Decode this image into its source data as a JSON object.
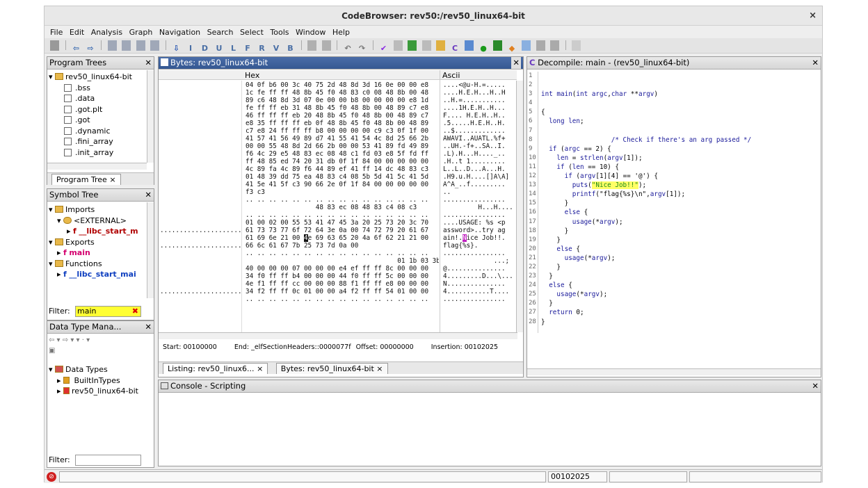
{
  "window": {
    "title": "CodeBrowser: rev50:/rev50_linux64-bit",
    "close": "×"
  },
  "menu": [
    "File",
    "Edit",
    "Analysis",
    "Graph",
    "Navigation",
    "Search",
    "Select",
    "Tools",
    "Window",
    "Help"
  ],
  "toolbar": [
    "⇦",
    "⇨",
    "I",
    "D",
    "U",
    "L",
    "F",
    "R",
    "V",
    "B"
  ],
  "program_trees": {
    "title": "Program Trees",
    "root": "rev50_linux64-bit",
    "items": [
      ".bss",
      ".data",
      ".got.plt",
      ".got",
      ".dynamic",
      ".fini_array",
      ".init_array"
    ],
    "tab": "Program Tree",
    "tab_close": "×"
  },
  "symbol_tree": {
    "title": "Symbol Tree",
    "imports": "Imports",
    "external": "<EXTERNAL>",
    "libc_import": "__libc_start_m",
    "exports": "Exports",
    "main": "main",
    "functions": "Functions",
    "libc_fn": "__libc_start_mai",
    "filter_label": "Filter:",
    "filter_value": "main"
  },
  "data_types": {
    "title": "Data Type Mana...",
    "root": "Data Types",
    "builtin": "BuiltInTypes",
    "program": "rev50_linux64-bit",
    "filter_label": "Filter:"
  },
  "bytes": {
    "title": "Bytes: rev50_linux64-bit",
    "hex_header": "Hex",
    "ascii_header": "Ascii",
    "addr_dots": [
      "",
      "",
      "",
      "",
      "",
      "",
      "",
      "",
      "",
      "",
      "",
      "",
      "",
      "",
      "",
      "",
      "",
      "",
      "",
      ".....................",
      "",
      ".....................",
      "",
      "",
      "",
      "",
      "",
      ".....................",
      "",
      "",
      "",
      "",
      "",
      "....................."
    ],
    "hex_rows": [
      "04 0f b6 00 3c 40 75 2d 48 8d 3d 16 0e 00 00 e8",
      "1c fe ff ff 48 8b 45 f0 48 83 c0 08 48 8b 00 48",
      "89 c6 48 8d 3d 07 0e 00 00 b8 00 00 00 00 e8 1d",
      "fe ff ff eb 31 48 8b 45 f0 48 8b 00 48 89 c7 e8",
      "46 ff ff ff eb 20 48 8b 45 f0 48 8b 00 48 89 c7",
      "e8 35 ff ff ff eb 0f 48 8b 45 f0 48 8b 00 48 89",
      "c7 e8 24 ff ff ff b8 00 00 00 00 c9 c3 0f 1f 00",
      "41 57 41 56 49 89 d7 41 55 41 54 4c 8d 25 66 2b",
      "00 00 55 48 8d 2d 66 2b 00 00 53 41 89 fd 49 89",
      "f6 4c 29 e5 48 83 ec 08 48 c1 fd 03 e8 5f fd ff",
      "ff 48 85 ed 74 20 31 db 0f 1f 84 00 00 00 00 00",
      "4c 89 fa 4c 89 f6 44 89 ef 41 ff 14 dc 48 83 c3",
      "01 48 39 dd 75 ea 48 83 c4 08 5b 5d 41 5c 41 5d",
      "41 5e 41 5f c3 90 66 2e 0f 1f 84 00 00 00 00 00",
      "f3 c3",
      ".. .. .. .. .. .. .. .. .. .. .. .. .. .. .. ..",
      "                  48 83 ec 08 48 83 c4 08 c3",
      ".. .. .. .. .. .. .. .. .. .. .. .. .. .. .. ..",
      "01 00 02 00 55 53 41 47 45 3a 20 25 73 20 3c 70",
      "61 73 73 77 6f 72 64 3e 0a 00 74 72 79 20 61 67",
      "61 69 6e 21 00 4e 69 63 65 20 4a 6f 62 21 21 00",
      "66 6c 61 67 7b 25 73 7d 0a 00",
      ".. .. .. .. .. .. .. .. .. .. .. .. .. .. .. ..",
      "                                       01 1b 03 3b",
      "40 00 00 00 07 00 00 00 e4 ef ff ff 8c 00 00 00",
      "34 f0 ff ff b4 00 00 00 44 f0 ff ff 5c 00 00 00",
      "4e f1 ff ff cc 00 00 00 88 f1 ff ff e8 00 00 00",
      "34 f2 ff ff 0c 01 00 00 a4 f2 ff ff 54 01 00 00",
      ".. .. .. .. .. .. .. .. .. .. .. .. .. .. .. .."
    ],
    "ascii_rows": [
      "....<@u-H.=.....",
      "....H.E.H...H..H",
      "..H.=...........",
      "....1H.E.H..H...",
      "F.... H.E.H..H..",
      ".5.....H.E.H..H.",
      "..$.............",
      "AWAVI..AUATL.%f+",
      "..UH.-f+..SA..I.",
      ".L).H...H...._..",
      ".H..t 1.........",
      "L..L..D...A...H.",
      ".H9.u.H....[]A\\A]",
      "A^A_..f.........",
      "..",
      "................",
      "         H...H....",
      "................",
      "....USAGE: %s <p",
      "assword>..try ag",
      "ain!.Nice Job!!.",
      "flag{%s}.",
      "................",
      "             ...;",
      "@...............",
      "4.........D...\\...",
      "N...............",
      "4...........T....",
      "................"
    ],
    "start_label": "Start: 00100000",
    "end_label": "End: _elfSectionHeaders::0000077f",
    "offset_label": "Offset: 00000000",
    "insertion_label": "Insertion: 00102025",
    "tab_listing": "Listing: rev50_linux6...",
    "tab_bytes": "Bytes: rev50_linux64-bit",
    "tab_close": "×"
  },
  "decompile": {
    "title": "Decompile: main -  (rev50_linux64-bit)",
    "line_numbers": [
      "1",
      "2",
      "3",
      "4",
      "5",
      "6",
      "7",
      "8",
      "9",
      "10",
      "11",
      "12",
      "13",
      "14",
      "15",
      "16",
      "17",
      "18",
      "19",
      "20",
      "21",
      "22",
      "23",
      "24",
      "25",
      "26",
      "27",
      "28"
    ]
  },
  "console": {
    "title": "Console - Scripting"
  },
  "status": {
    "address": "00102025"
  }
}
